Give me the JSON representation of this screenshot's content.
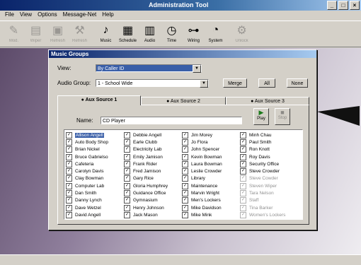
{
  "window": {
    "title": "Administration Tool"
  },
  "menu": [
    "File",
    "View",
    "Options",
    "Message-Net",
    "Help"
  ],
  "toolbar": [
    {
      "label": "Mod.",
      "icon": "pencil-icon",
      "enabled": false
    },
    {
      "label": "Wiper",
      "icon": "printer-icon",
      "enabled": false
    },
    {
      "label": "Refresh",
      "icon": "refresh-icon",
      "enabled": false
    },
    {
      "label": "Refresh",
      "icon": "tools-icon",
      "enabled": false
    },
    {
      "label": "Music",
      "icon": "music-note-icon",
      "enabled": true
    },
    {
      "label": "Schedule",
      "icon": "calendar-icon",
      "enabled": true
    },
    {
      "label": "Audio",
      "icon": "speakers-icon",
      "enabled": true
    },
    {
      "label": "Time",
      "icon": "clock-icon",
      "enabled": true
    },
    {
      "label": "Wiring",
      "icon": "wiring-icon",
      "enabled": true
    },
    {
      "label": "System",
      "icon": "gauge-icon",
      "enabled": true
    },
    {
      "label": "Unlock",
      "icon": "gear-icon",
      "enabled": false
    }
  ],
  "dialog": {
    "title": "Music Groups",
    "view_label": "View:",
    "view_value": "By Caller ID",
    "audio_group_label": "Audio Group:",
    "audio_group_value": "1 - School Wide",
    "merge_label": "Merge",
    "all_label": "All",
    "none_label": "None",
    "tabs": [
      "Aux Source 1",
      "Aux Source 2",
      "Aux Source 3"
    ],
    "name_label": "Name:",
    "name_value": "CD Player",
    "play_label": "Play",
    "stop_label": "Stop",
    "columns": [
      [
        "Allison Angell",
        "Auto Body Shop",
        "Brian Nickel",
        "Bruce Gabrielso",
        "Cafeteria",
        "Carolyn Davis",
        "Clay Bowman",
        "Computer Lab",
        "Dan Smith",
        "Danny Lynch",
        "Dave Wetzel",
        "David Angell"
      ],
      [
        "Debbie Angell",
        "Earle Clubb",
        "Electricity Lab",
        "Emily Jamison",
        "Frank Rider",
        "Fred Jamison",
        "Gary Rice",
        "Gloria Humphrey",
        "Guidance Office",
        "Gymnasium",
        "Henry Johnson",
        "Jack Mason"
      ],
      [
        "Jim Morey",
        "Jo Flora",
        "John Spencer",
        "Kevin Bowman",
        "Laura Bowman",
        "Leslie Crowder",
        "Library",
        "Maintenance",
        "Marvin Wright",
        "Men's Lockers",
        "Mike Davidson",
        "Mike Mink"
      ],
      [
        "Minh Chau",
        "Paul Smith",
        "Ron Knott",
        "Roy Davis",
        "Security Office",
        "Steve Crowder",
        "Steve Cowder",
        "Steven Wiper",
        "Tara Nelson",
        "Staff",
        "Tina Barker",
        "Women's Lockers"
      ]
    ]
  }
}
